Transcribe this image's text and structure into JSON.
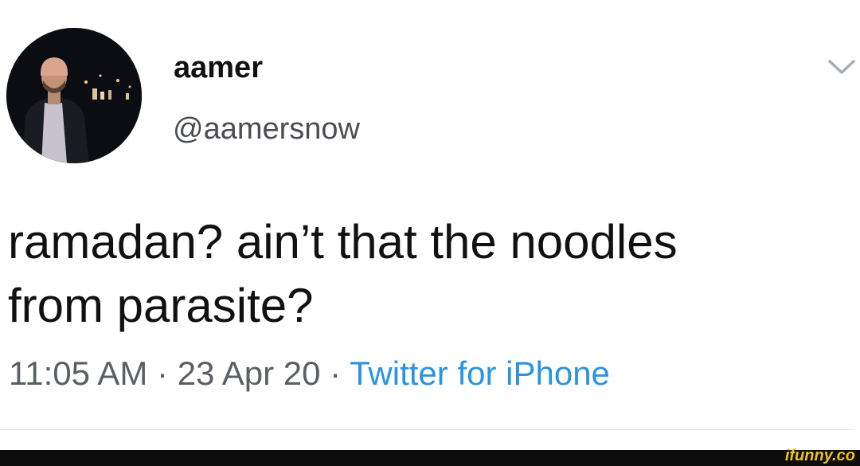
{
  "tweet": {
    "author": {
      "display_name": "aamer",
      "handle": "@aamersnow",
      "avatar_icon": "user-avatar-photo"
    },
    "menu_icon": "chevron-down-icon",
    "text_line_1": "ramadan? ain’t that the noodles",
    "text_line_2": "from parasite?",
    "meta": {
      "time": "11:05 AM",
      "separator": "·",
      "date": "23 Apr 20",
      "source": "Twitter for iPhone"
    }
  },
  "watermark": {
    "text": "ifunny.co"
  },
  "colors": {
    "source_link": "#2b93e0",
    "watermark": "#f2c21b",
    "bottom_bar": "#0d0d0d"
  }
}
